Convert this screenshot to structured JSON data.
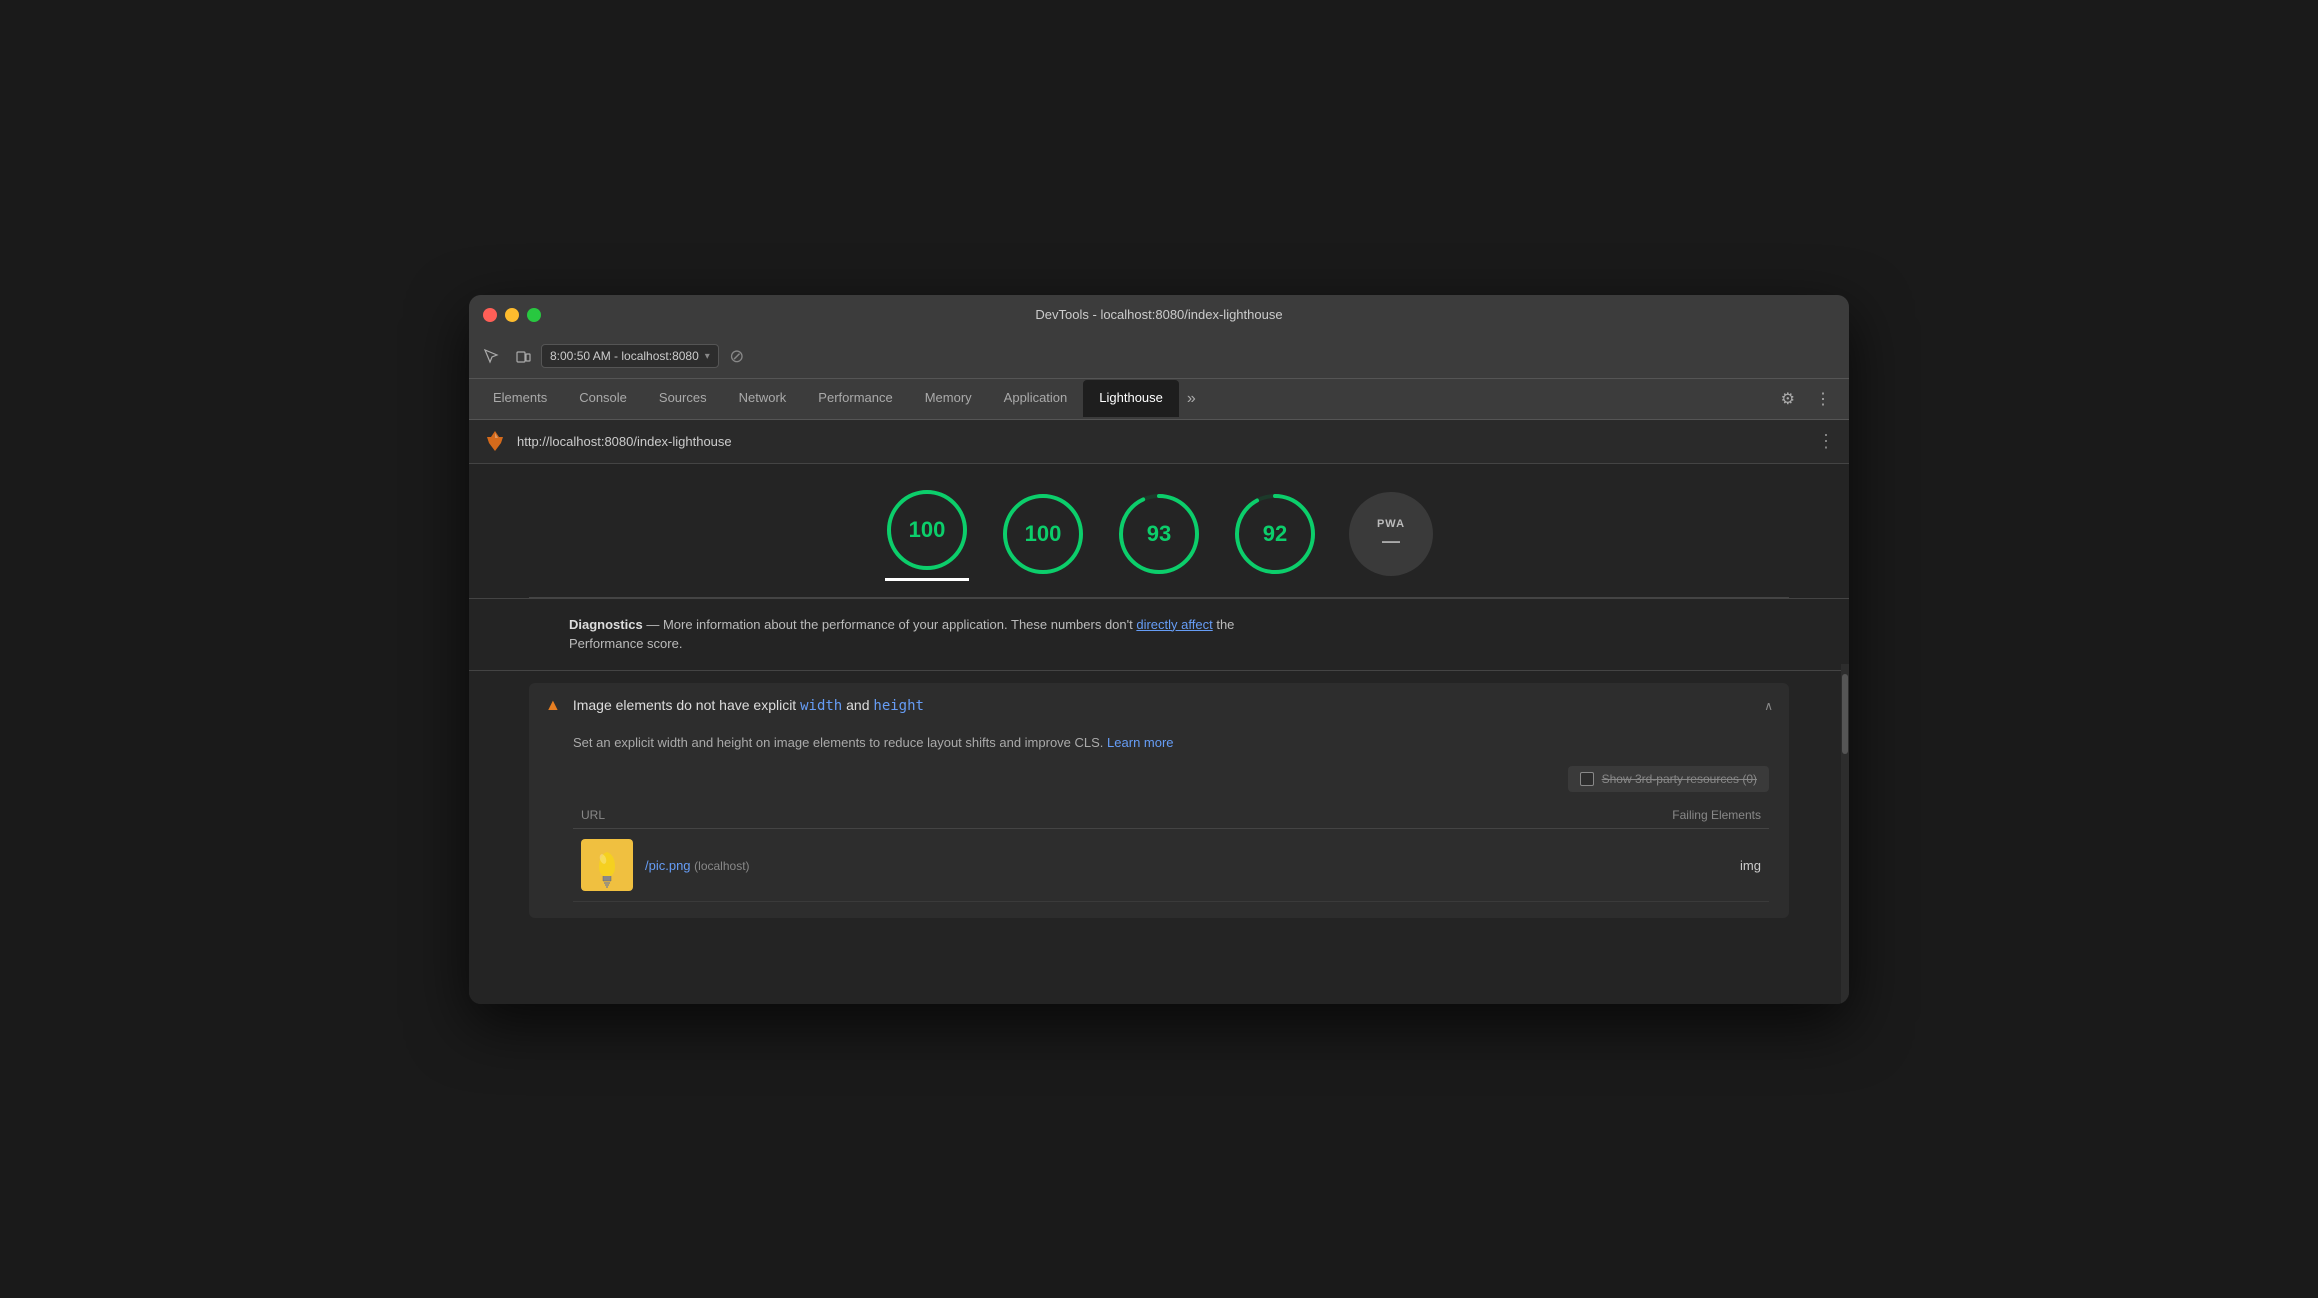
{
  "window": {
    "title": "DevTools - localhost:8080/index-lighthouse",
    "traffic_lights": [
      "red",
      "yellow",
      "green"
    ]
  },
  "toolbar": {
    "address": "8:00:50 AM - localhost:8080",
    "address_dropdown": "▾",
    "inspect_icon": "⬡",
    "device_icon": "⬜",
    "reload_icon": "⊘"
  },
  "tabs": {
    "items": [
      {
        "label": "Elements",
        "active": false
      },
      {
        "label": "Console",
        "active": false
      },
      {
        "label": "Sources",
        "active": false
      },
      {
        "label": "Network",
        "active": false
      },
      {
        "label": "Performance",
        "active": false
      },
      {
        "label": "Memory",
        "active": false
      },
      {
        "label": "Application",
        "active": false
      },
      {
        "label": "Lighthouse",
        "active": true
      }
    ],
    "more_label": "»",
    "settings_icon": "⚙",
    "more_options_icon": "⋮"
  },
  "url_row": {
    "url": "http://localhost:8080/index-lighthouse",
    "more_icon": "⋮"
  },
  "scores": [
    {
      "value": "100",
      "type": "green",
      "underline": true
    },
    {
      "value": "100",
      "type": "green",
      "underline": false
    },
    {
      "value": "93",
      "type": "green",
      "underline": false
    },
    {
      "value": "92",
      "type": "green",
      "underline": false
    },
    {
      "value": "PWA",
      "sub": "—",
      "type": "gray",
      "underline": false
    }
  ],
  "diagnostics": {
    "title": "Diagnostics",
    "dash": "—",
    "text": "More information about the performance of your application. These numbers don't",
    "link_text": "directly affect",
    "text2": "the",
    "text3": "Performance score."
  },
  "audit": {
    "warning_icon": "▲",
    "title_prefix": "Image elements do not have explicit",
    "code1": "width",
    "and": "and",
    "code2": "height",
    "chevron": "∧",
    "description": "Set an explicit width and height on image elements to reduce layout shifts and improve CLS.",
    "learn_more": "Learn more",
    "show_3rd_label": "Show 3rd-party resources (0)",
    "table": {
      "headers": [
        "URL",
        "Failing Elements"
      ],
      "rows": [
        {
          "url_link": "/pic.png",
          "url_host": "(localhost)",
          "failing": "img"
        }
      ]
    }
  }
}
